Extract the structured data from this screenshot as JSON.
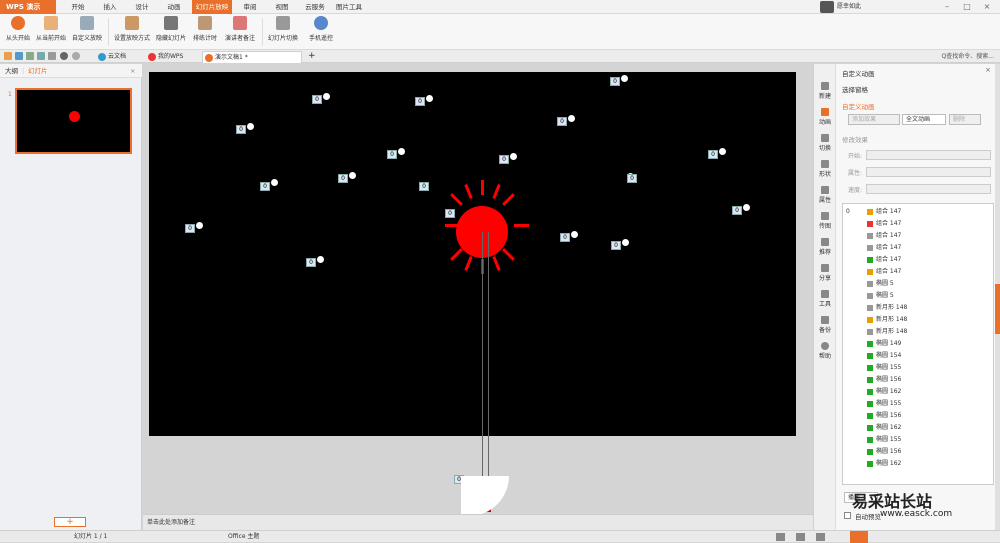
{
  "app": {
    "title": "WPS 演示",
    "user": "愿幸如此"
  },
  "menu": [
    "开始",
    "插入",
    "设计",
    "动画",
    "幻灯片放映",
    "审阅",
    "视图",
    "云服务",
    "图片工具"
  ],
  "ribbon": {
    "items": [
      "从头开始",
      "从当前开始",
      "自定义放映",
      "设置放映方式",
      "隐藏幻灯片",
      "排练计时",
      "演讲者备注",
      "幻灯片切换",
      "手机遥控"
    ]
  },
  "doctabs": {
    "tabs": [
      "云文档",
      "我的WPS",
      "演示文稿1 *"
    ],
    "search": "Q查找命令、搜索..."
  },
  "left": {
    "tab_outline": "大纲",
    "tab_slides": "幻灯片",
    "slide_number": "1"
  },
  "slide": {
    "tags": [
      "0",
      "0",
      "0",
      "0",
      "0",
      "0",
      "0",
      "0",
      "0",
      "0",
      "0",
      "0",
      "0",
      "0",
      "0",
      "0",
      "0",
      "0"
    ]
  },
  "notes": "单击此处添加备注",
  "vtools": [
    "新建",
    "动画",
    "切换",
    "形状",
    "属性",
    "传图",
    "推荐",
    "分享",
    "工具",
    "备份",
    "帮助"
  ],
  "right": {
    "title": "自定义动画",
    "select_pane": "选择窗格",
    "section": "自定义动画",
    "add_effect": "添加效果",
    "full_anim": "全文动画",
    "delete": "删除",
    "modify": "修改效果",
    "start": "开始:",
    "property": "属性:",
    "speed": "速度:",
    "list": [
      {
        "idx": "0",
        "name": "组合 147",
        "color": "#e8a000"
      },
      {
        "idx": "",
        "name": "组合 147",
        "color": "#e33"
      },
      {
        "idx": "",
        "name": "组合 147",
        "color": "#999"
      },
      {
        "idx": "",
        "name": "组合 147",
        "color": "#999"
      },
      {
        "idx": "",
        "name": "组合 147",
        "color": "#2a2"
      },
      {
        "idx": "",
        "name": "组合 147",
        "color": "#e8a000"
      },
      {
        "idx": "",
        "name": "椭圆 5",
        "color": "#999"
      },
      {
        "idx": "",
        "name": "椭圆 5",
        "color": "#999"
      },
      {
        "idx": "",
        "name": "新月形 148",
        "color": "#999"
      },
      {
        "idx": "",
        "name": "新月形 148",
        "color": "#e8a000"
      },
      {
        "idx": "",
        "name": "新月形 148",
        "color": "#999"
      },
      {
        "idx": "",
        "name": "椭圆 149",
        "color": "#2a2"
      },
      {
        "idx": "",
        "name": "椭圆 154",
        "color": "#2a2"
      },
      {
        "idx": "",
        "name": "椭圆 155",
        "color": "#2a2"
      },
      {
        "idx": "",
        "name": "椭圆 156",
        "color": "#2a2"
      },
      {
        "idx": "",
        "name": "椭圆 162",
        "color": "#2a2"
      },
      {
        "idx": "",
        "name": "椭圆 155",
        "color": "#2a2"
      },
      {
        "idx": "",
        "name": "椭圆 156",
        "color": "#2a2"
      },
      {
        "idx": "",
        "name": "椭圆 162",
        "color": "#2a2"
      },
      {
        "idx": "",
        "name": "椭圆 155",
        "color": "#2a2"
      },
      {
        "idx": "",
        "name": "椭圆 156",
        "color": "#2a2"
      },
      {
        "idx": "",
        "name": "椭圆 162",
        "color": "#2a2"
      }
    ],
    "play": "播放",
    "auto_preview": "自动预览"
  },
  "status": {
    "slide": "幻灯片 1 / 1",
    "theme": "Office 主题"
  },
  "watermark": {
    "text": "易采站长站",
    "url": "www.easck.com"
  }
}
